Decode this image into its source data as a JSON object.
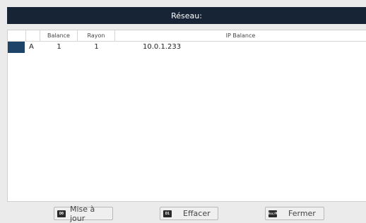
{
  "window": {
    "title": "Réseau:"
  },
  "table": {
    "columns": [
      "",
      "",
      "Balance",
      "Rayon",
      "IP Balance"
    ],
    "rows": [
      {
        "id": "A",
        "balance": "1",
        "rayon": "1",
        "ip": "10.0.1.233"
      }
    ]
  },
  "buttons": {
    "update": {
      "key": "D0",
      "label": "Mise à jour"
    },
    "clear": {
      "key": "D1",
      "label": "Effacer"
    },
    "close": {
      "key": "Esc/M",
      "label": "Fermer"
    }
  }
}
